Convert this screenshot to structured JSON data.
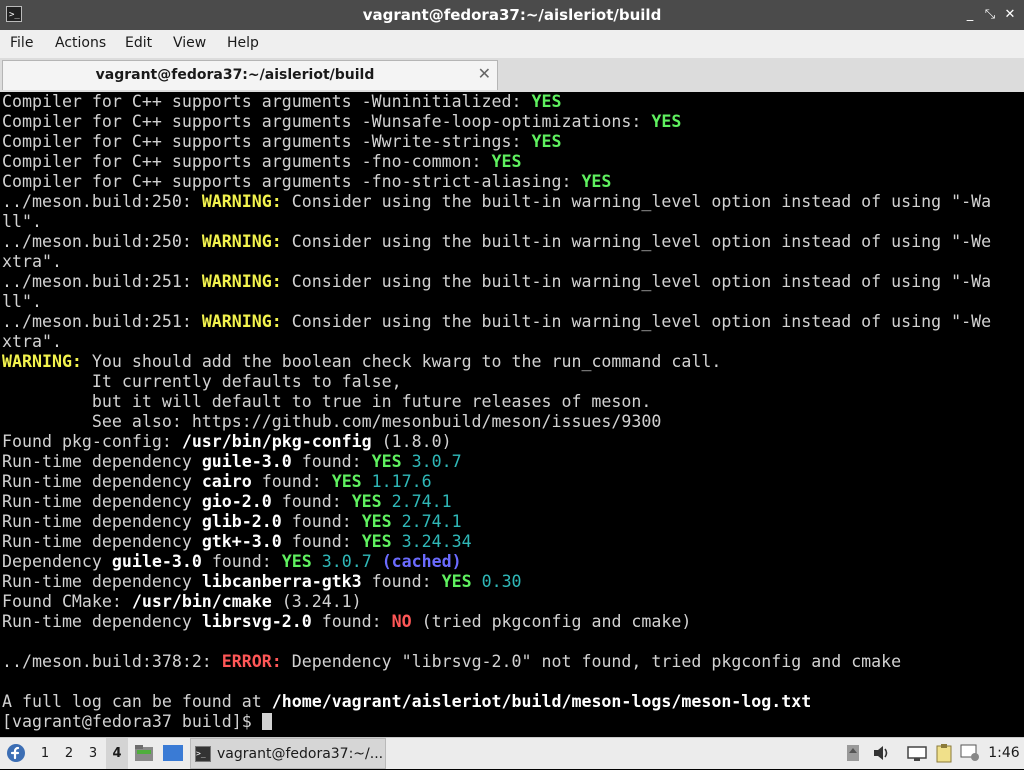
{
  "window": {
    "title": "vagrant@fedora37:~/aisleriot/build",
    "controls": {
      "minimize": "_",
      "maximize": "⤡",
      "close": "✕"
    }
  },
  "menu": [
    "File",
    "Actions",
    "Edit",
    "View",
    "Help"
  ],
  "tab": {
    "label": "vagrant@fedora37:~/aisleriot/build",
    "close": "✕"
  },
  "terminal": {
    "lines": [
      [
        {
          "t": "Compiler for C++ supports arguments -Wuninitialized: "
        },
        {
          "t": "YES",
          "c": "g"
        }
      ],
      [
        {
          "t": "Compiler for C++ supports arguments -Wunsafe-loop-optimizations: "
        },
        {
          "t": "YES",
          "c": "g"
        }
      ],
      [
        {
          "t": "Compiler for C++ supports arguments -Wwrite-strings: "
        },
        {
          "t": "YES",
          "c": "g"
        }
      ],
      [
        {
          "t": "Compiler for C++ supports arguments -fno-common: "
        },
        {
          "t": "YES",
          "c": "g"
        }
      ],
      [
        {
          "t": "Compiler for C++ supports arguments -fno-strict-aliasing: "
        },
        {
          "t": "YES",
          "c": "g"
        }
      ],
      [
        {
          "t": "../meson.build:250: "
        },
        {
          "t": "WARNING:",
          "c": "y"
        },
        {
          "t": " Consider using the built-in warning_level option instead of using \"-Wa"
        }
      ],
      [
        {
          "t": "ll\"."
        }
      ],
      [
        {
          "t": "../meson.build:250: "
        },
        {
          "t": "WARNING:",
          "c": "y"
        },
        {
          "t": " Consider using the built-in warning_level option instead of using \"-We"
        }
      ],
      [
        {
          "t": "xtra\"."
        }
      ],
      [
        {
          "t": "../meson.build:251: "
        },
        {
          "t": "WARNING:",
          "c": "y"
        },
        {
          "t": " Consider using the built-in warning_level option instead of using \"-Wa"
        }
      ],
      [
        {
          "t": "ll\"."
        }
      ],
      [
        {
          "t": "../meson.build:251: "
        },
        {
          "t": "WARNING:",
          "c": "y"
        },
        {
          "t": " Consider using the built-in warning_level option instead of using \"-We"
        }
      ],
      [
        {
          "t": "xtra\"."
        }
      ],
      [
        {
          "t": "WARNING:",
          "c": "y"
        },
        {
          "t": " You should add the boolean check kwarg to the run_command call."
        }
      ],
      [
        {
          "t": "         It currently defaults to false,"
        }
      ],
      [
        {
          "t": "         but it will default to true in future releases of meson."
        }
      ],
      [
        {
          "t": "         See also: https://github.com/mesonbuild/meson/issues/9300"
        }
      ],
      [
        {
          "t": "Found pkg-config: "
        },
        {
          "t": "/usr/bin/pkg-config",
          "c": "w"
        },
        {
          "t": " (1.8.0)"
        }
      ],
      [
        {
          "t": "Run-time dependency "
        },
        {
          "t": "guile-3.0",
          "c": "w"
        },
        {
          "t": " found: "
        },
        {
          "t": "YES",
          "c": "g"
        },
        {
          "t": " 3.0.7",
          "c": "c"
        }
      ],
      [
        {
          "t": "Run-time dependency "
        },
        {
          "t": "cairo",
          "c": "w"
        },
        {
          "t": " found: "
        },
        {
          "t": "YES",
          "c": "g"
        },
        {
          "t": " 1.17.6",
          "c": "c"
        }
      ],
      [
        {
          "t": "Run-time dependency "
        },
        {
          "t": "gio-2.0",
          "c": "w"
        },
        {
          "t": " found: "
        },
        {
          "t": "YES",
          "c": "g"
        },
        {
          "t": " 2.74.1",
          "c": "c"
        }
      ],
      [
        {
          "t": "Run-time dependency "
        },
        {
          "t": "glib-2.0",
          "c": "w"
        },
        {
          "t": " found: "
        },
        {
          "t": "YES",
          "c": "g"
        },
        {
          "t": " 2.74.1",
          "c": "c"
        }
      ],
      [
        {
          "t": "Run-time dependency "
        },
        {
          "t": "gtk+-3.0",
          "c": "w"
        },
        {
          "t": " found: "
        },
        {
          "t": "YES",
          "c": "g"
        },
        {
          "t": " 3.24.34",
          "c": "c"
        }
      ],
      [
        {
          "t": "Dependency "
        },
        {
          "t": "guile-3.0",
          "c": "w"
        },
        {
          "t": " found: "
        },
        {
          "t": "YES",
          "c": "g"
        },
        {
          "t": " 3.0.7",
          "c": "c"
        },
        {
          "t": " (cached)",
          "c": "b"
        }
      ],
      [
        {
          "t": "Run-time dependency "
        },
        {
          "t": "libcanberra-gtk3",
          "c": "w"
        },
        {
          "t": " found: "
        },
        {
          "t": "YES",
          "c": "g"
        },
        {
          "t": " 0.30",
          "c": "c"
        }
      ],
      [
        {
          "t": "Found CMake: "
        },
        {
          "t": "/usr/bin/cmake",
          "c": "w"
        },
        {
          "t": " (3.24.1)"
        }
      ],
      [
        {
          "t": "Run-time dependency "
        },
        {
          "t": "librsvg-2.0",
          "c": "w"
        },
        {
          "t": " found: "
        },
        {
          "t": "NO",
          "c": "r"
        },
        {
          "t": " (tried pkgconfig and cmake)"
        }
      ],
      [],
      [
        {
          "t": "../meson.build:378:2: "
        },
        {
          "t": "ERROR:",
          "c": "r"
        },
        {
          "t": " Dependency \"librsvg-2.0\" not found, tried pkgconfig and cmake"
        }
      ],
      [],
      [
        {
          "t": "A full log can be found at "
        },
        {
          "t": "/home/vagrant/aisleriot/build/meson-logs/meson-log.txt",
          "c": "w"
        }
      ],
      [
        {
          "t": "[vagrant@fedora37 build]$ "
        }
      ]
    ]
  },
  "taskbar": {
    "workspaces": [
      "1",
      "2",
      "3",
      "4"
    ],
    "active_workspace": "4",
    "task_label": "vagrant@fedora37:~/...",
    "clock": "1:46"
  },
  "colors": {
    "titlebar": "#4b4b4b",
    "menubar": "#efefef",
    "terminal_bg": "#000000",
    "green": "#5ff15f",
    "yellow": "#f3f34d",
    "red": "#ff5757",
    "cyan": "#2fb8b8",
    "blue": "#6b6bff"
  }
}
